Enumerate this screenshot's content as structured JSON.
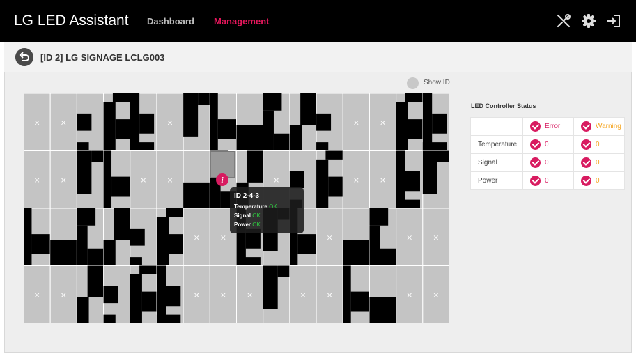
{
  "app": {
    "title": "LG LED Assistant"
  },
  "nav": {
    "dashboard": "Dashboard",
    "management": "Management"
  },
  "toolbar_icons": [
    "tools-icon",
    "gear-icon",
    "logout-icon"
  ],
  "page": {
    "title": "[ID 2] LG SIGNAGE LCLG003"
  },
  "show_id": {
    "label": "Show ID",
    "enabled": false
  },
  "tooltip": {
    "id": "ID 2-4-3",
    "rows": [
      {
        "label": "Temperature",
        "value": "OK"
      },
      {
        "label": "Signal",
        "value": "OK"
      },
      {
        "label": "Power",
        "value": "OK"
      }
    ]
  },
  "status": {
    "title": "LED Controller Status",
    "headers": {
      "error": "Error",
      "warning": "Warning"
    },
    "rows": [
      {
        "label": "Temperature",
        "error": "0",
        "warning": "0"
      },
      {
        "label": "Signal",
        "error": "0",
        "warning": "0"
      },
      {
        "label": "Power",
        "error": "0",
        "warning": "0"
      }
    ]
  },
  "grid": {
    "columns": 16,
    "rows": 4,
    "selected_cabinet": "ID 2-4-3",
    "cabinets": [
      [
        "empty",
        "empty",
        "pattern",
        "pattern",
        "pattern",
        "empty",
        "pattern",
        "pattern",
        "pattern",
        "pattern",
        "pattern",
        "pattern",
        "empty",
        "empty",
        "pattern",
        "pattern"
      ],
      [
        "empty",
        "empty",
        "pattern",
        "pattern",
        "empty",
        "empty",
        "pattern",
        "pattern",
        "pattern",
        "empty",
        "pattern",
        "pattern",
        "empty",
        "empty",
        "pattern",
        "pattern"
      ],
      [
        "pattern",
        "pattern",
        "pattern",
        "pattern",
        "pattern",
        "pattern",
        "empty",
        "empty",
        "pattern",
        "pattern",
        "pattern",
        "empty",
        "pattern",
        "pattern",
        "empty",
        "empty"
      ],
      [
        "empty",
        "empty",
        "pattern",
        "pattern",
        "pattern",
        "pattern",
        "empty",
        "empty",
        "empty",
        "pattern",
        "empty",
        "empty",
        "pattern",
        "pattern",
        "empty",
        "empty"
      ]
    ],
    "empty_glyph": "×",
    "colors": {
      "cabinet": "#c4c4c4",
      "pixels": "#000000",
      "grid_line": "#ffffff"
    }
  },
  "colors": {
    "accent": "#d81b60",
    "warning": "#f5a623",
    "ok": "#2ecc40",
    "topbar": "#000000"
  }
}
